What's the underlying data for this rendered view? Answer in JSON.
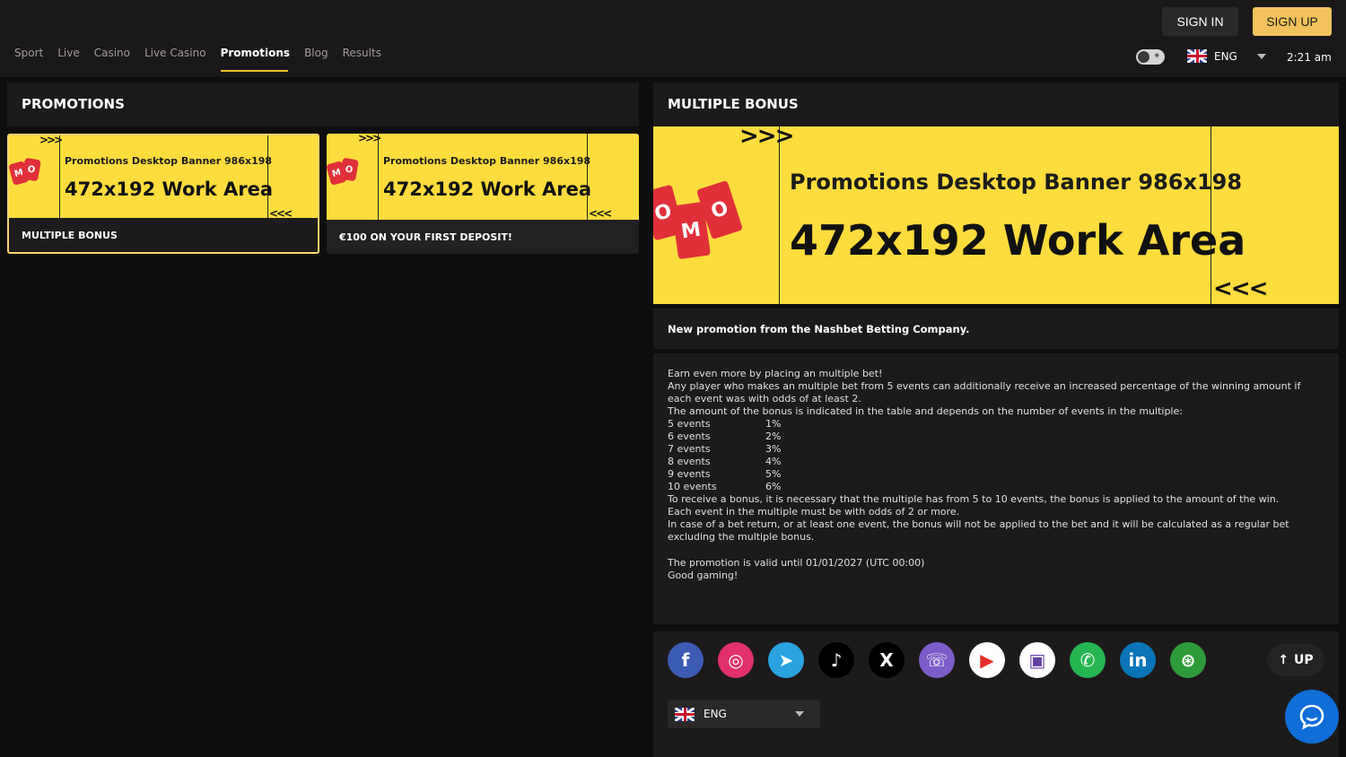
{
  "nav": {
    "items": [
      {
        "label": "Sport",
        "active": false
      },
      {
        "label": "Live",
        "active": false
      },
      {
        "label": "Casino",
        "active": false
      },
      {
        "label": "Live Casino",
        "active": false
      },
      {
        "label": "Promotions",
        "active": true
      },
      {
        "label": "Blog",
        "active": false
      },
      {
        "label": "Results",
        "active": false
      }
    ]
  },
  "header": {
    "sign_in": "SIGN IN",
    "sign_up": "SIGN UP",
    "language": "ENG",
    "time": "2:21 am"
  },
  "left": {
    "title": "PROMOTIONS",
    "cards": [
      {
        "caption": "MULTIPLE BONUS",
        "selected": true
      },
      {
        "caption": "€100 ON YOUR FIRST DEPOSIT!",
        "selected": false
      }
    ]
  },
  "banner": {
    "line1": "Promotions Desktop Banner 986x198",
    "line2": "472x192 Work Area",
    "tag_text_a": "MO",
    "tag_text_b": "OMO",
    "arrows_right": ">>>",
    "arrows_left": "<<<"
  },
  "detail": {
    "title": "MULTIPLE BONUS",
    "subtitle": "New promotion from the Nashbet Betting Company.",
    "intro": [
      "Earn even more by placing an multiple bet!",
      "Any player who makes an multiple bet from 5 events can additionally receive an increased percentage of the winning amount if each event was with odds of at least 2.",
      "The amount of the bonus is indicated in the table and depends on the number of events in the multiple:"
    ],
    "table": [
      {
        "events": "5 events",
        "bonus": "1%"
      },
      {
        "events": "6 events",
        "bonus": "2%"
      },
      {
        "events": "7 events",
        "bonus": "3%"
      },
      {
        "events": "8 events",
        "bonus": "4%"
      },
      {
        "events": "9 events",
        "bonus": "5%"
      },
      {
        "events": "10 events",
        "bonus": "6%"
      }
    ],
    "rules": [
      "To receive a bonus, it is necessary that the multiple has from 5 to 10 events, the bonus is applied to the amount of the win.",
      "Each event in the multiple must be with odds of 2 or more.",
      "In case of a bet return, or at least one event, the bonus will not be applied to the bet and it will be calculated as a regular bet excluding the multiple bonus."
    ],
    "validity": "The promotion is valid until 01/01/2027 (UTC 00:00)",
    "closing": "Good gaming!"
  },
  "footer": {
    "social": [
      {
        "name": "facebook-icon",
        "glyph": "f",
        "color": "#3b5bb5"
      },
      {
        "name": "instagram-icon",
        "glyph": "◎",
        "color": "#e1306c"
      },
      {
        "name": "telegram-icon",
        "glyph": "➤",
        "color": "#2aa3e0"
      },
      {
        "name": "tiktok-icon",
        "glyph": "♪",
        "color": "#000000"
      },
      {
        "name": "x-icon",
        "glyph": "X",
        "color": "#000000"
      },
      {
        "name": "viber-icon",
        "glyph": "☏",
        "color": "#7b5cc9"
      },
      {
        "name": "youtube-icon",
        "glyph": "▶",
        "color": "#ffffff"
      },
      {
        "name": "twitch-icon",
        "glyph": "▣",
        "color": "#ffffff"
      },
      {
        "name": "whatsapp-icon",
        "glyph": "✆",
        "color": "#25b553"
      },
      {
        "name": "linkedin-icon",
        "glyph": "in",
        "color": "#0a74b8"
      },
      {
        "name": "responsible-gaming-icon",
        "glyph": "⊛",
        "color": "#2e9b3a"
      }
    ],
    "up_label": "UP",
    "up_arrow": "↑",
    "language": "ENG"
  }
}
